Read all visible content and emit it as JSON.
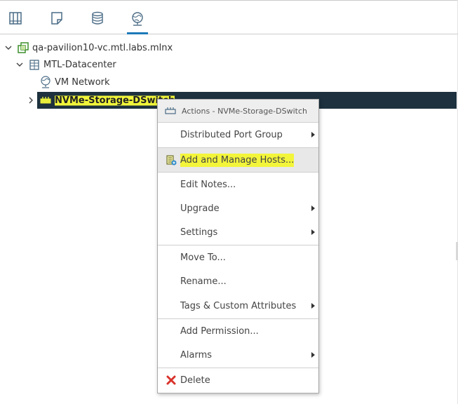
{
  "nav_tabs": [
    {
      "icon": "hosts-and-clusters-icon"
    },
    {
      "icon": "vms-and-templates-icon"
    },
    {
      "icon": "storage-icon"
    },
    {
      "icon": "networking-icon",
      "active": true
    }
  ],
  "tree": {
    "vcenter": {
      "label": "qa-pavilion10-vc.mtl.labs.mlnx",
      "icon": "vcenter-icon"
    },
    "datacenter": {
      "label": "MTL-Datacenter",
      "icon": "datacenter-icon"
    },
    "vm_network": {
      "label": "VM Network",
      "icon": "network-icon"
    },
    "dswitch": {
      "label": "NVMe-Storage-DSwitch",
      "icon": "distributed-switch-icon",
      "selected": true
    }
  },
  "context_menu": {
    "header": "Actions - NVMe-Storage-DSwitch",
    "items": {
      "distributed_port_group": {
        "label": "Distributed Port Group",
        "submenu": true
      },
      "add_manage_hosts": {
        "label": "Add and Manage Hosts...",
        "hover": true
      },
      "edit_notes": {
        "label": "Edit Notes..."
      },
      "upgrade": {
        "label": "Upgrade",
        "submenu": true
      },
      "settings": {
        "label": "Settings",
        "submenu": true
      },
      "move_to": {
        "label": "Move To..."
      },
      "rename": {
        "label": "Rename..."
      },
      "tags": {
        "label": "Tags & Custom Attributes",
        "submenu": true
      },
      "add_permission": {
        "label": "Add Permission..."
      },
      "alarms": {
        "label": "Alarms",
        "submenu": true
      },
      "delete": {
        "label": "Delete"
      }
    }
  },
  "colors": {
    "accent": "#1d7ab8",
    "selection": "#1d313e",
    "highlight": "#f0f53a",
    "delete_red": "#d9332b"
  }
}
